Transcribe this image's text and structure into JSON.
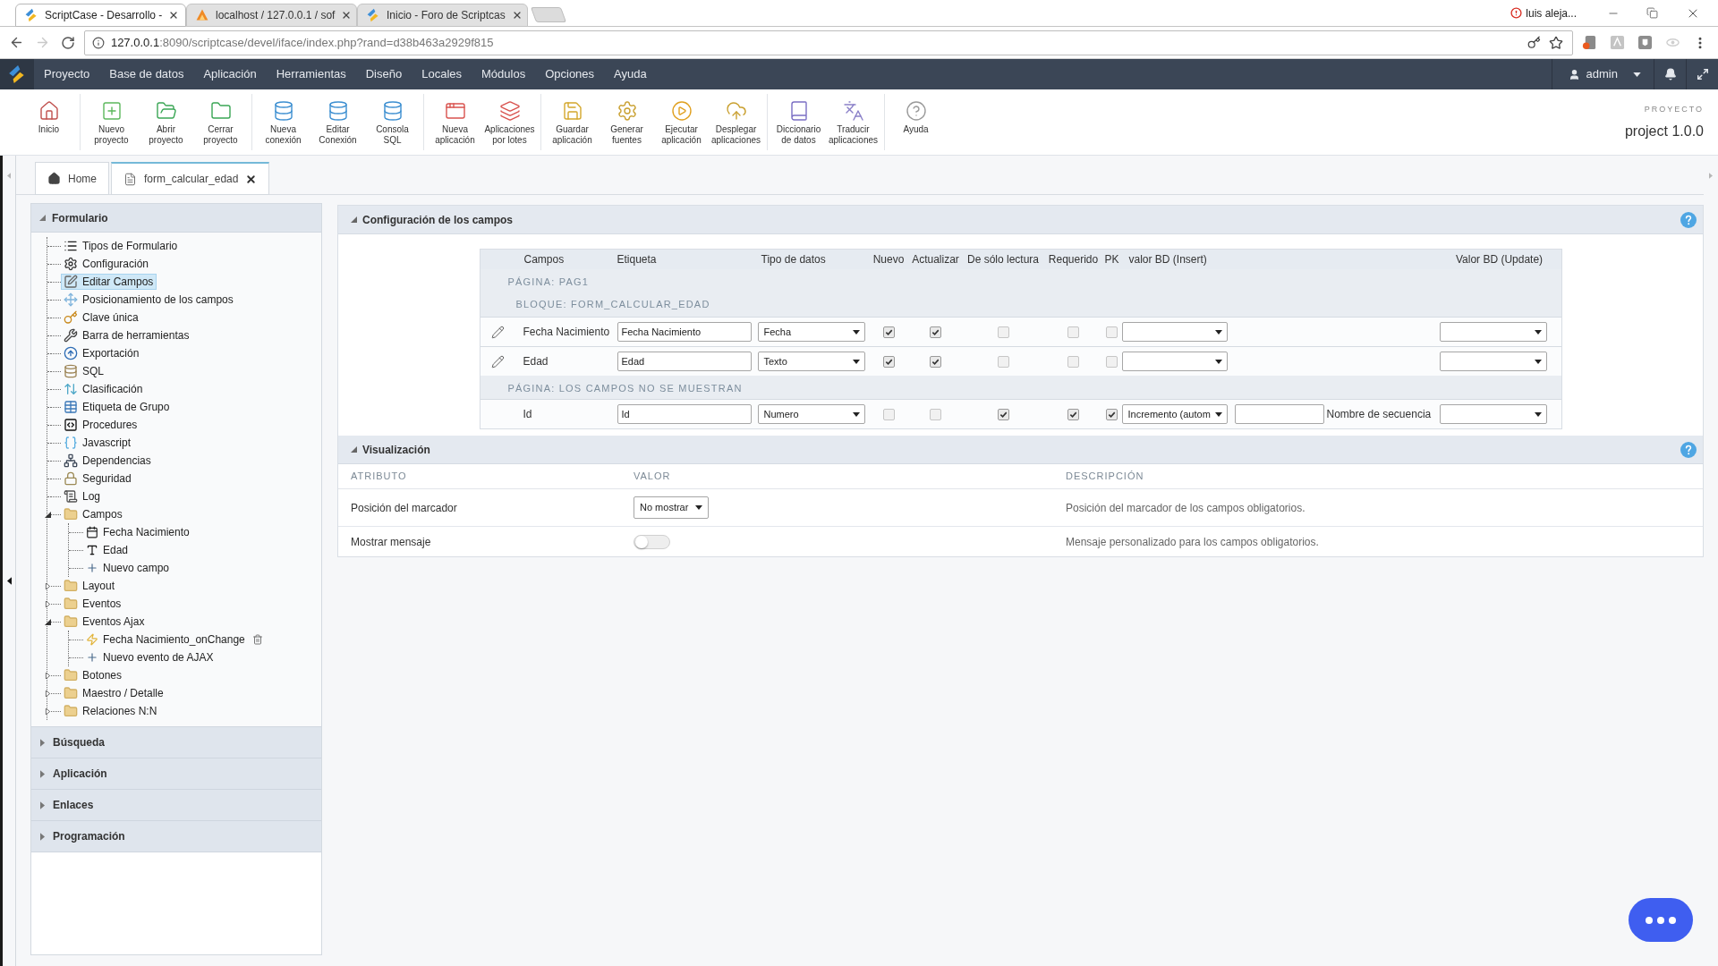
{
  "browser": {
    "tabs": [
      {
        "title": "ScriptCase - Desarrollo -",
        "selected": true
      },
      {
        "title": "localhost / 127.0.0.1 / sof",
        "selected": false
      },
      {
        "title": "Inicio - Foro de Scriptcas",
        "selected": false
      }
    ],
    "profile": "luis aleja...",
    "forward_disabled": true,
    "url_host": "127.0.0.1",
    "url_path": ":8090/scriptcase/devel/iface/index.php?rand=d38b463a2929f815"
  },
  "app_menu": {
    "items": [
      "Proyecto",
      "Base de datos",
      "Aplicación",
      "Herramientas",
      "Diseño",
      "Locales",
      "Módulos",
      "Opciones",
      "Ayuda"
    ],
    "user": "admin"
  },
  "toolbar": {
    "groups": [
      [
        "Inicio"
      ],
      [
        "Nuevo\nproyecto",
        "Abrir\nproyecto",
        "Cerrar\nproyecto"
      ],
      [
        "Nueva\nconexión",
        "Editar\nConexión",
        "Consola\nSQL"
      ],
      [
        "Nueva\naplicación",
        "Aplicaciones\npor lotes"
      ],
      [
        "Guardar\naplicación",
        "Generar\nfuentes",
        "Ejecutar\naplicación",
        "Desplegar\naplicaciones"
      ],
      [
        "Diccionario\nde datos",
        "Traducir\naplicaciones"
      ],
      [
        "Ayuda"
      ]
    ],
    "project_caption": "PROYECTO",
    "project_name": "project 1.0.0"
  },
  "doc_tabs": [
    {
      "label": "Home",
      "selected": false,
      "closable": false
    },
    {
      "label": "form_calcular_edad",
      "selected": true,
      "closable": true
    }
  ],
  "sidebar": {
    "title": "Formulario",
    "expanded": true,
    "tree": [
      {
        "label": "Tipos de Formulario",
        "selected": false
      },
      {
        "label": "Configuración",
        "selected": false
      },
      {
        "label": "Editar Campos",
        "selected": true
      },
      {
        "label": "Posicionamiento de los campos",
        "selected": false
      },
      {
        "label": "Clave única",
        "selected": false
      },
      {
        "label": "Barra de herramientas",
        "selected": false
      },
      {
        "label": "Exportación",
        "selected": false
      },
      {
        "label": "SQL",
        "selected": false
      },
      {
        "label": "Clasificación",
        "selected": false
      },
      {
        "label": "Etiqueta de Grupo",
        "selected": false
      },
      {
        "label": "Procedures",
        "selected": false
      },
      {
        "label": "Javascript",
        "selected": false
      },
      {
        "label": "Dependencias",
        "selected": false
      },
      {
        "label": "Seguridad",
        "selected": false
      },
      {
        "label": "Log",
        "selected": false
      },
      {
        "label": "Campos",
        "selected": false,
        "expanded": true,
        "children": [
          {
            "label": "Fecha Nacimiento",
            "selected": false
          },
          {
            "label": "Edad",
            "selected": false
          },
          {
            "label": "Nuevo campo",
            "selected": false
          }
        ]
      },
      {
        "label": "Layout",
        "selected": false,
        "expanded": false
      },
      {
        "label": "Eventos",
        "selected": false,
        "expanded": false
      },
      {
        "label": "Eventos Ajax",
        "selected": false,
        "expanded": true,
        "children": [
          {
            "label": "Fecha Nacimiento_onChange",
            "selected": false
          },
          {
            "label": "Nuevo evento de AJAX",
            "selected": false
          }
        ]
      },
      {
        "label": "Botones",
        "selected": false,
        "expanded": false
      },
      {
        "label": "Maestro / Detalle",
        "selected": false,
        "expanded": false
      },
      {
        "label": "Relaciones N:N",
        "selected": false,
        "expanded": false
      }
    ],
    "sections": [
      {
        "title": "Búsqueda",
        "expanded": false
      },
      {
        "title": "Aplicación",
        "expanded": false
      },
      {
        "title": "Enlaces",
        "expanded": false
      },
      {
        "title": "Programación",
        "expanded": false
      }
    ]
  },
  "fields_panel": {
    "title": "Configuración de los campos",
    "expanded": true,
    "columns": [
      "Campos",
      "Etiqueta",
      "Tipo de datos",
      "Nuevo",
      "Actualizar",
      "De sólo lectura",
      "Requerido",
      "PK",
      "valor BD (Insert)",
      "Valor BD (Update)"
    ],
    "rows": [
      {
        "kind": "page",
        "text": "PÁGINA: PAG1"
      },
      {
        "kind": "block",
        "text": "BLOQUE: FORM_CALCULAR_EDAD"
      },
      {
        "kind": "field",
        "editable": true,
        "name": "Fecha Nacimiento",
        "label": "Fecha Nacimiento",
        "type": "Fecha",
        "nuevo": true,
        "actualizar": true,
        "solo_lectura": false,
        "requerido": false,
        "pk": false
      },
      {
        "kind": "field",
        "editable": true,
        "name": "Edad",
        "label": "Edad",
        "type": "Texto",
        "nuevo": true,
        "actualizar": true,
        "solo_lectura": false,
        "requerido": false,
        "pk": false
      },
      {
        "kind": "page",
        "text": "PÁGINA: LOS CAMPOS NO SE MUESTRAN"
      },
      {
        "kind": "field",
        "editable": false,
        "name": "Id",
        "label": "Id",
        "type": "Numero",
        "nuevo": false,
        "actualizar": false,
        "solo_lectura": true,
        "requerido": true,
        "pk": true,
        "insert_value": "Incremento (autom",
        "sequence_label": "Nombre de secuencia"
      }
    ]
  },
  "display_panel": {
    "title": "Visualización",
    "expanded": true,
    "columns": [
      "ATRIBUTO",
      "VALOR",
      "DESCRIPCIÓN"
    ],
    "rows": [
      {
        "kind": "select",
        "attribute": "Posición del marcador",
        "value": "No mostrar",
        "description": "Posición del marcador de los campos obligatorios."
      },
      {
        "kind": "toggle",
        "attribute": "Mostrar mensaje",
        "on": false,
        "description": "Mensaje personalizado para los campos obligatorios."
      }
    ]
  }
}
